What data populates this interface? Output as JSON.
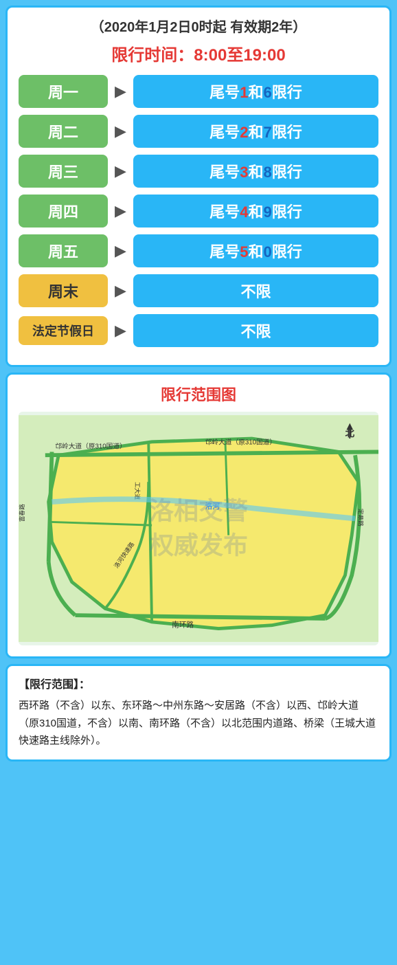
{
  "header": {
    "title": "（2020年1月2日0时起 有效期2年）"
  },
  "timeRange": {
    "label": "限行时间：8:00至19:00"
  },
  "schedule": [
    {
      "day": "周一",
      "dayStyle": "green",
      "restriction": "尾号",
      "num1": "1",
      "num1Color": "red",
      "mid": "和",
      "num2": "6",
      "num2Color": "blue",
      "suffix": "限行"
    },
    {
      "day": "周二",
      "dayStyle": "green",
      "restriction": "尾号",
      "num1": "2",
      "num1Color": "red",
      "mid": "和",
      "num2": "7",
      "num2Color": "blue",
      "suffix": "限行"
    },
    {
      "day": "周三",
      "dayStyle": "green",
      "restriction": "尾号",
      "num1": "3",
      "num1Color": "red",
      "mid": "和",
      "num2": "8",
      "num2Color": "blue",
      "suffix": "限行"
    },
    {
      "day": "周四",
      "dayStyle": "green",
      "restriction": "尾号",
      "num1": "4",
      "num1Color": "red",
      "mid": "和",
      "num2": "9",
      "num2Color": "blue",
      "suffix": "限行"
    },
    {
      "day": "周五",
      "dayStyle": "green",
      "restriction": "尾号",
      "num1": "5",
      "num1Color": "red",
      "mid": "和",
      "num2": "0",
      "num2Color": "blue",
      "suffix": "限行"
    },
    {
      "day": "周末",
      "dayStyle": "yellow",
      "restriction": "不限",
      "num1": "",
      "num1Color": "",
      "mid": "",
      "num2": "",
      "num2Color": "",
      "suffix": ""
    },
    {
      "day": "法定节假日",
      "dayStyle": "yellow",
      "restriction": "不限",
      "num1": "",
      "num1Color": "",
      "mid": "",
      "num2": "",
      "num2Color": "",
      "suffix": ""
    }
  ],
  "mapSection": {
    "title": "限行范围图",
    "northLabel": "北",
    "watermarkLine1": "洛相交警",
    "watermarkLine2": "权威发布",
    "roadLabels": [
      {
        "text": "邙岭大道（原310国道）",
        "position": "top-left"
      },
      {
        "text": "邙岭大道（原310国道）",
        "position": "top-right"
      },
      {
        "text": "南环路",
        "position": "bottom"
      },
      {
        "text": "洛河",
        "position": "mid-right"
      },
      {
        "text": "洛河快速路",
        "position": "mid-bottom-left"
      },
      {
        "text": "工大道",
        "position": "mid-left"
      }
    ]
  },
  "bottomSection": {
    "title": "【限行范围】：",
    "content": "西环路（不含）以东、东环路～中州东路～安居路（不含）以西、邙岭大道（原310国道，不含）以南、南环路（不含）以北范围内道路、桥梁（王城大道快速路主线除外）。"
  }
}
